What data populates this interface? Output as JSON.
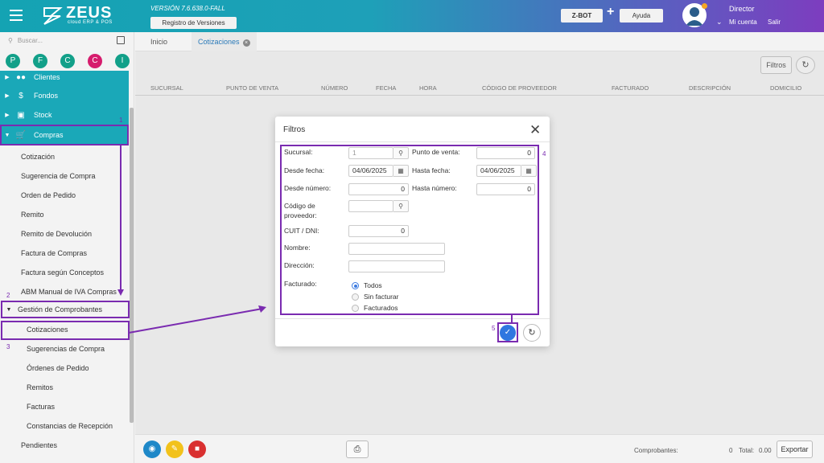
{
  "header": {
    "app_name": "ZEUS",
    "app_sub": "cloud ERP & POS",
    "version": "VERSIÓN 7.6.638.0-FALL",
    "registro_label": "Registro de Versiones",
    "zbot_label": "Z-BOT",
    "plus": "+",
    "ayuda_label": "Ayuda",
    "user_name": "Director",
    "mi_cuenta": "Mi cuenta",
    "salir": "Salir"
  },
  "sidebar": {
    "search_placeholder": "Buscar...",
    "circles": [
      {
        "letter": "P",
        "color": "#12a089"
      },
      {
        "letter": "F",
        "color": "#12a089"
      },
      {
        "letter": "C",
        "color": "#12a089"
      },
      {
        "letter": "C",
        "color": "#d61c6d"
      },
      {
        "letter": "I",
        "color": "#12a089"
      }
    ],
    "menu": [
      "Clientes",
      "Fondos",
      "Stock",
      "Compras"
    ],
    "compras_items": [
      "Cotización",
      "Sugerencia de Compra",
      "Orden de Pedido",
      "Remito",
      "Remito de Devolución",
      "Factura de Compras",
      "Factura según Conceptos",
      "ABM Manual de IVA Compras"
    ],
    "gestion_label": "Gestión de Comprobantes",
    "gestion_items": [
      "Cotizaciones",
      "Sugerencias de Compra",
      "Órdenes de Pedido",
      "Remitos",
      "Facturas",
      "Constancias de Recepción"
    ],
    "pendientes": "Pendientes"
  },
  "tabs": {
    "inicio": "Inicio",
    "cotizaciones": "Cotizaciones"
  },
  "toolbar": {
    "filtros": "Filtros"
  },
  "table": {
    "columns": [
      "SUCURSAL",
      "PUNTO DE VENTA",
      "NÚMERO",
      "FECHA",
      "HORA",
      "CÓDIGO DE PROVEEDOR",
      "FACTURADO",
      "DESCRIPCIÓN",
      "DOMICILIO"
    ]
  },
  "footer": {
    "comprobantes_label": "Comprobantes:",
    "comprobantes_value": "0",
    "total_label": "Total:",
    "total_value": "0.00",
    "exportar": "Exportar"
  },
  "modal": {
    "title": "Filtros",
    "sucursal_label": "Sucursal:",
    "sucursal_value": "1",
    "punto_venta_label": "Punto de venta:",
    "punto_venta_value": "0",
    "desde_fecha_label": "Desde fecha:",
    "desde_fecha_value": "04/06/2025",
    "hasta_fecha_label": "Hasta fecha:",
    "hasta_fecha_value": "04/06/2025",
    "desde_numero_label": "Desde número:",
    "desde_numero_value": "0",
    "hasta_numero_label": "Hasta número:",
    "hasta_numero_value": "0",
    "codigo_proveedor_label_1": "Código de",
    "codigo_proveedor_label_2": "proveedor:",
    "cuit_label": "CUIT / DNI:",
    "cuit_value": "0",
    "nombre_label": "Nombre:",
    "direccion_label": "Dirección:",
    "facturado_label": "Facturado:",
    "facturado_options": [
      "Todos",
      "Sin facturar",
      "Facturados"
    ],
    "facturado_selected": "Todos"
  },
  "annotations": [
    "1",
    "2",
    "3",
    "4",
    "5"
  ]
}
